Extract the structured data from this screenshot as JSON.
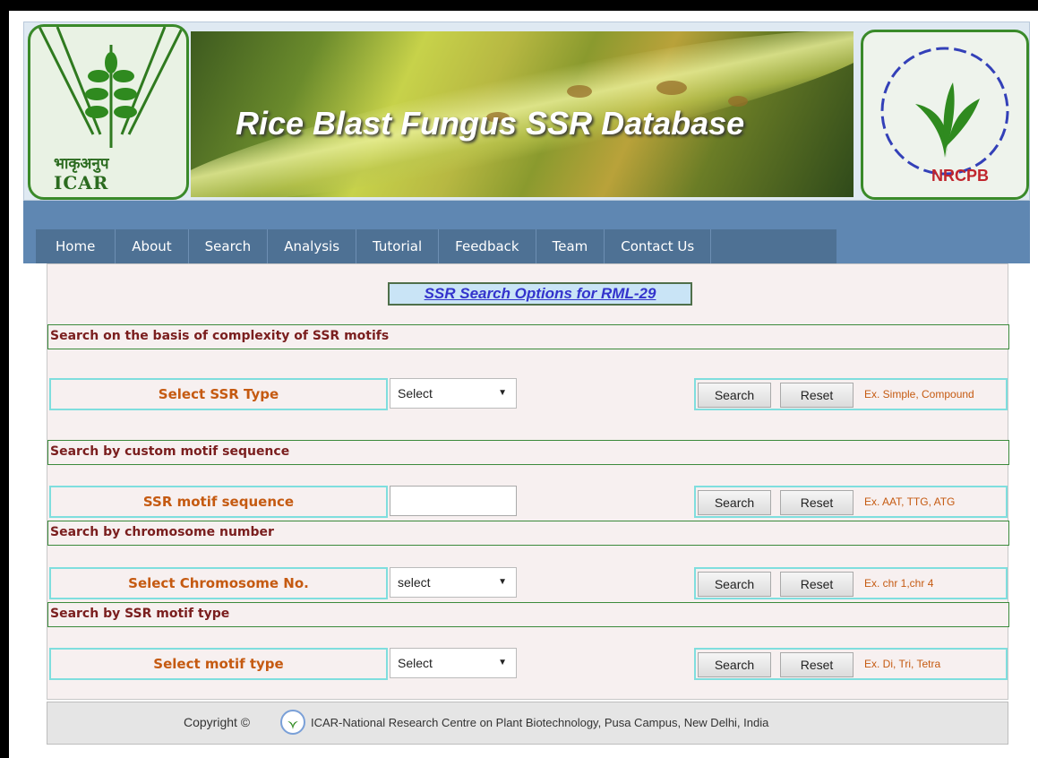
{
  "banner": {
    "title": "Rice Blast Fungus SSR Database",
    "left_logo_hindi": "भाकृअनुप",
    "left_logo_text": "ICAR",
    "right_logo_text": "NRCPB"
  },
  "nav": {
    "items": [
      "Home",
      "About",
      "Search",
      "Analysis",
      "Tutorial",
      "Feedback",
      "Team",
      "Contact Us"
    ]
  },
  "panel": {
    "title": "SSR Search Options for RML-29",
    "sections": [
      {
        "heading": "Search on the basis of complexity of SSR motifs",
        "label": "Select SSR Type",
        "control": "select",
        "value": "Select",
        "search": "Search",
        "reset": "Reset",
        "example": "Ex. Simple, Compound"
      },
      {
        "heading": "Search by custom motif sequence",
        "label": "SSR motif sequence",
        "control": "input",
        "value": "",
        "search": "Search",
        "reset": "Reset",
        "example": "Ex. AAT, TTG, ATG"
      },
      {
        "heading": "Search by chromosome number",
        "label": "Select Chromosome No.",
        "control": "select",
        "value": "select",
        "search": "Search",
        "reset": "Reset",
        "example": "Ex. chr 1,chr 4"
      },
      {
        "heading": "Search by SSR motif type",
        "label": "Select motif type",
        "control": "select",
        "value": "Select",
        "search": "Search",
        "reset": "Reset",
        "example": "Ex. Di, Tri, Tetra"
      }
    ]
  },
  "footer": {
    "copyright": "Copyright ©",
    "text": "ICAR-National Research Centre on Plant Biotechnology, Pusa Campus, New Delhi, India"
  }
}
